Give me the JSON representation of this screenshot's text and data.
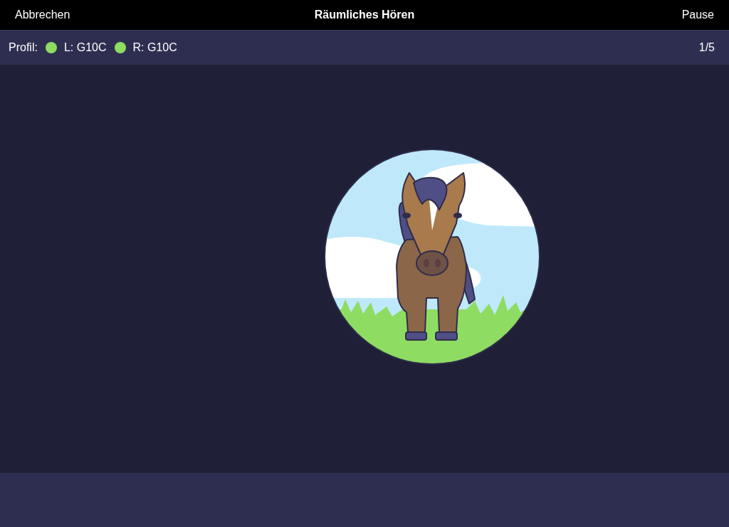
{
  "nav": {
    "cancel": "Abbrechen",
    "title": "Räumliches Hören",
    "pause": "Pause"
  },
  "profile": {
    "label": "Profil:",
    "ears": [
      {
        "text": "L: G10C",
        "color": "#8fdc63"
      },
      {
        "text": "R: G10C",
        "color": "#8fdc63"
      }
    ],
    "progress": "1/5"
  }
}
